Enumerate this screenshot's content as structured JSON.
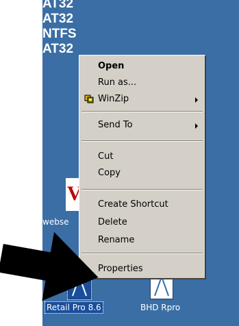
{
  "desktop": {
    "drive_labels": [
      "AT32",
      "AT32",
      "NTFS",
      "AT32"
    ],
    "icons": [
      {
        "label": "webse",
        "name": "webse-icon"
      },
      {
        "label": "Retail Pro 8.6",
        "name": "retail-pro-icon",
        "selected": true
      },
      {
        "label": "BHD Rpro",
        "name": "bhd-rpro-icon",
        "selected": false
      }
    ],
    "background_color": "#3a6ea5"
  },
  "context_menu": {
    "items": {
      "open": "Open",
      "run_as": "Run as...",
      "winzip": "WinZip",
      "send_to": "Send To",
      "cut": "Cut",
      "copy": "Copy",
      "create_shortcut": "Create Shortcut",
      "delete": "Delete",
      "rename": "Rename",
      "properties": "Properties"
    },
    "menu_color": "#d4d0c8"
  }
}
